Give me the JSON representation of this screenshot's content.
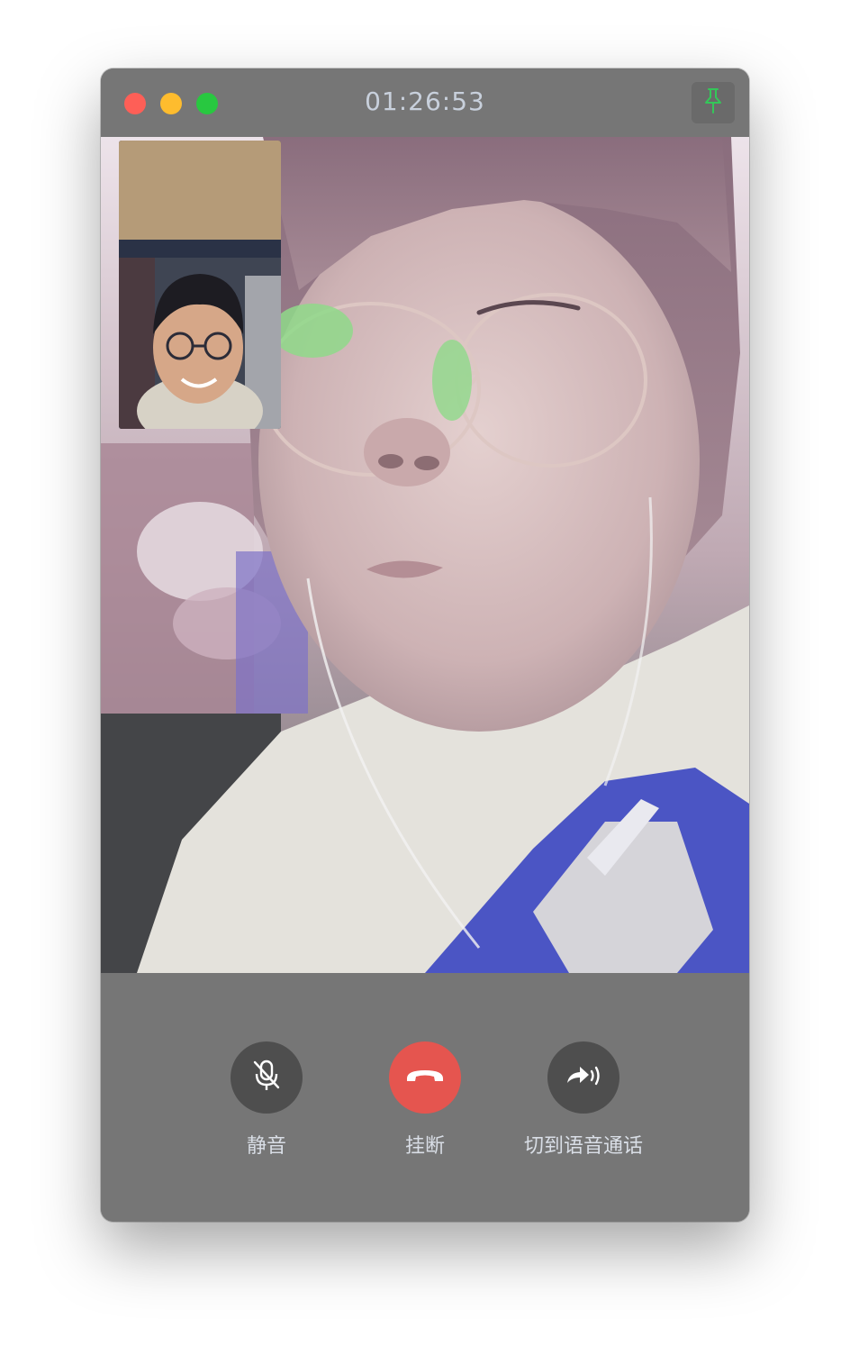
{
  "window": {
    "call_timer": "01:26:53"
  },
  "controls": {
    "mute_label": "静音",
    "hangup_label": "挂断",
    "switch_audio_label": "切到语音通话"
  },
  "colors": {
    "window_bg": "#767676",
    "hangup": "#e5554f",
    "control_dark": "#4e4e4e",
    "pin_icon": "#34c759",
    "timer_text": "#c8d0dc"
  },
  "icons": {
    "window_pin": "pin-icon",
    "mute": "microphone-off-icon",
    "hangup": "phone-hangup-icon",
    "switch_audio": "switch-to-voice-icon"
  }
}
